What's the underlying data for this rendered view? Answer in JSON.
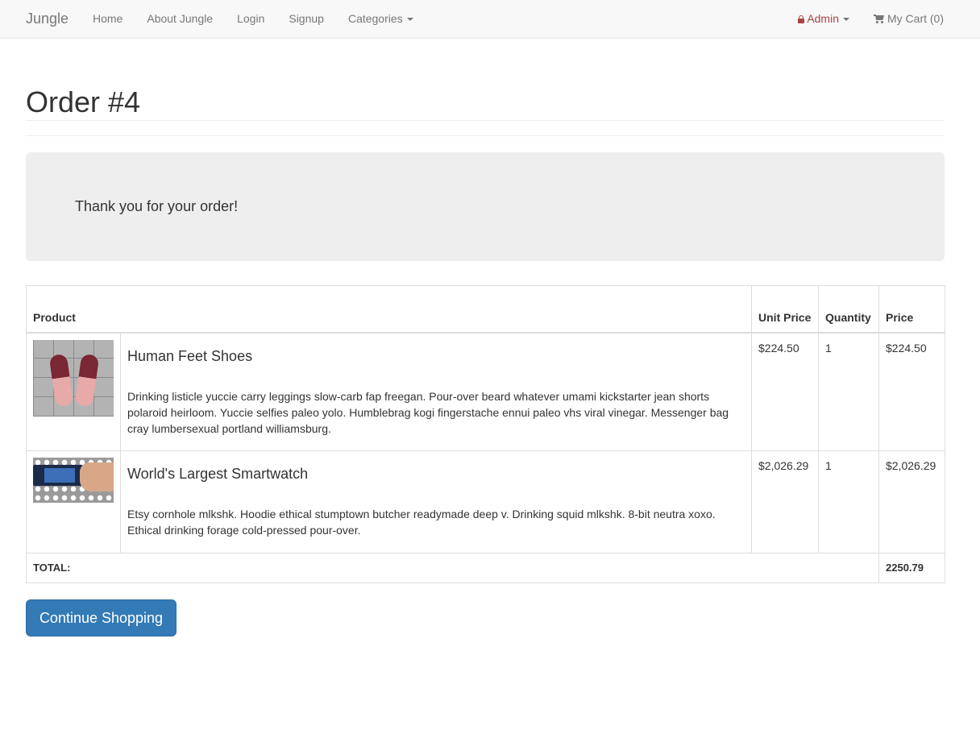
{
  "navbar": {
    "brand": "Jungle",
    "links": [
      {
        "label": "Home"
      },
      {
        "label": "About Jungle"
      },
      {
        "label": "Login"
      },
      {
        "label": "Signup"
      },
      {
        "label": "Categories"
      }
    ],
    "admin_label": "Admin",
    "cart_label": "My Cart (0)",
    "admin_color": "#a94442"
  },
  "page": {
    "title": "Order #4",
    "thank_you": "Thank you for your order!"
  },
  "table": {
    "headers": {
      "product": "Product",
      "unit_price": "Unit Price",
      "quantity": "Quantity",
      "price": "Price"
    },
    "rows": [
      {
        "name": "Human Feet Shoes",
        "description": "Drinking listicle yuccie carry leggings slow-carb fap freegan. Pour-over beard whatever umami kickstarter jean shorts polaroid heirloom. Yuccie selfies paleo yolo. Humblebrag kogi fingerstache ennui paleo vhs viral vinegar. Messenger bag cray lumbersexual portland williamsburg.",
        "unit_price": "$224.50",
        "quantity": "1",
        "price": "$224.50",
        "image": "human-feet-shoes-photo"
      },
      {
        "name": "World's Largest Smartwatch",
        "description": "Etsy cornhole mlkshk. Hoodie ethical stumptown butcher readymade deep v. Drinking squid mlkshk. 8-bit neutra xoxo. Ethical drinking forage cold-pressed pour-over.",
        "unit_price": "$2,026.29",
        "quantity": "1",
        "price": "$2,026.29",
        "image": "smartwatch-photo"
      }
    ],
    "total_label": "TOTAL:",
    "total_value": "2250.79"
  },
  "actions": {
    "continue_label": "Continue Shopping",
    "primary_color": "#337ab7"
  }
}
